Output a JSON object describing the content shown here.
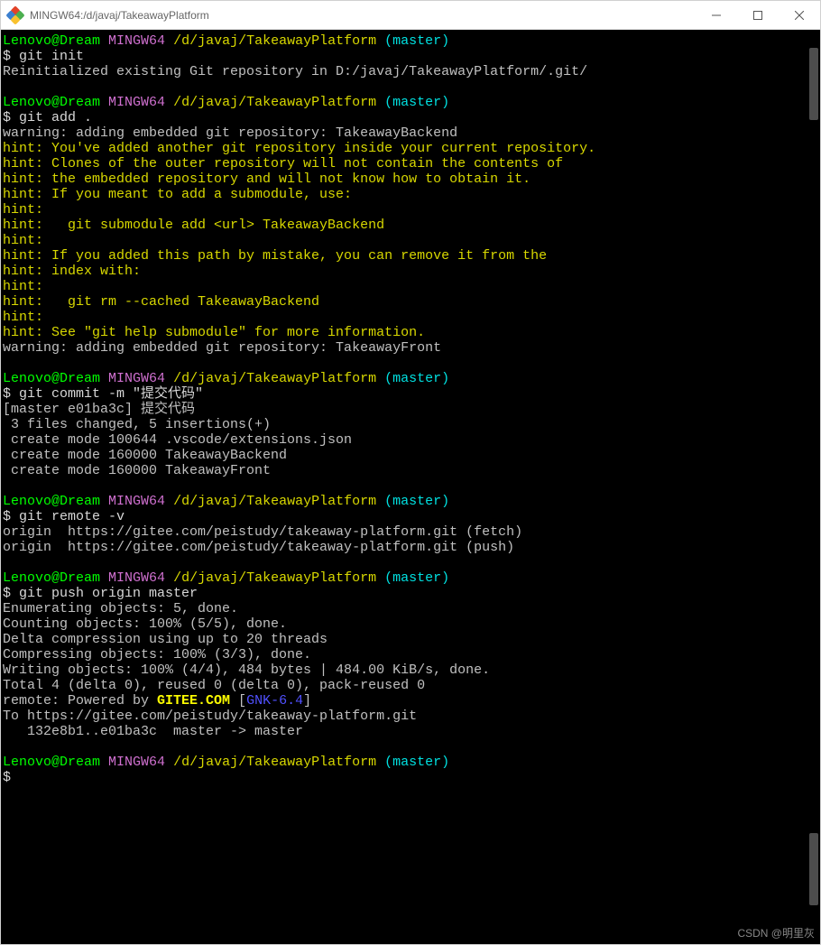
{
  "window": {
    "title": "MINGW64:/d/javaj/TakeawayPlatform"
  },
  "prompt": {
    "user": "Lenovo@Dream",
    "shell": "MINGW64",
    "path": "/d/javaj/TakeawayPlatform",
    "branch": "(master)",
    "symbol": "$"
  },
  "blocks": [
    {
      "cmd": "git init",
      "out": [
        {
          "t": "gray",
          "s": "Reinitialized existing Git repository in D:/javaj/TakeawayPlatform/.git/"
        }
      ]
    },
    {
      "cmd": "git add .",
      "out": [
        {
          "t": "gray",
          "s": "warning: adding embedded git repository: TakeawayBackend"
        },
        {
          "t": "yellow",
          "s": "hint: You've added another git repository inside your current repository."
        },
        {
          "t": "yellow",
          "s": "hint: Clones of the outer repository will not contain the contents of"
        },
        {
          "t": "yellow",
          "s": "hint: the embedded repository and will not know how to obtain it."
        },
        {
          "t": "yellow",
          "s": "hint: If you meant to add a submodule, use:"
        },
        {
          "t": "yellow",
          "s": "hint:"
        },
        {
          "t": "yellow",
          "s": "hint:   git submodule add <url> TakeawayBackend"
        },
        {
          "t": "yellow",
          "s": "hint:"
        },
        {
          "t": "yellow",
          "s": "hint: If you added this path by mistake, you can remove it from the"
        },
        {
          "t": "yellow",
          "s": "hint: index with:"
        },
        {
          "t": "yellow",
          "s": "hint:"
        },
        {
          "t": "yellow",
          "s": "hint:   git rm --cached TakeawayBackend"
        },
        {
          "t": "yellow",
          "s": "hint:"
        },
        {
          "t": "yellow",
          "s": "hint: See \"git help submodule\" for more information."
        },
        {
          "t": "gray",
          "s": "warning: adding embedded git repository: TakeawayFront"
        }
      ]
    },
    {
      "cmd": "git commit -m \"提交代码\"",
      "out": [
        {
          "t": "gray",
          "s": "[master e01ba3c] 提交代码"
        },
        {
          "t": "gray",
          "s": " 3 files changed, 5 insertions(+)"
        },
        {
          "t": "gray",
          "s": " create mode 100644 .vscode/extensions.json"
        },
        {
          "t": "gray",
          "s": " create mode 160000 TakeawayBackend"
        },
        {
          "t": "gray",
          "s": " create mode 160000 TakeawayFront"
        }
      ]
    },
    {
      "cmd": "git remote -v",
      "out": [
        {
          "t": "gray",
          "s": "origin  https://gitee.com/peistudy/takeaway-platform.git (fetch)"
        },
        {
          "t": "gray",
          "s": "origin  https://gitee.com/peistudy/takeaway-platform.git (push)"
        }
      ]
    },
    {
      "cmd": "git push origin master",
      "out": [
        {
          "t": "gray",
          "s": "Enumerating objects: 5, done."
        },
        {
          "t": "gray",
          "s": "Counting objects: 100% (5/5), done."
        },
        {
          "t": "gray",
          "s": "Delta compression using up to 20 threads"
        },
        {
          "t": "gray",
          "s": "Compressing objects: 100% (3/3), done."
        },
        {
          "t": "gray",
          "s": "Writing objects: 100% (4/4), 484 bytes | 484.00 KiB/s, done."
        },
        {
          "t": "gray",
          "s": "Total 4 (delta 0), reused 0 (delta 0), pack-reused 0"
        },
        {
          "t": "remote",
          "pre": "remote: Powered by ",
          "gitee": "GITEE.COM",
          "mid": " [",
          "gnk": "GNK-6.4",
          "post": "]"
        },
        {
          "t": "gray",
          "s": "To https://gitee.com/peistudy/takeaway-platform.git"
        },
        {
          "t": "gray",
          "s": "   132e8b1..e01ba3c  master -> master"
        }
      ]
    },
    {
      "cmd": "",
      "out": []
    }
  ],
  "watermark": "CSDN @明里灰"
}
